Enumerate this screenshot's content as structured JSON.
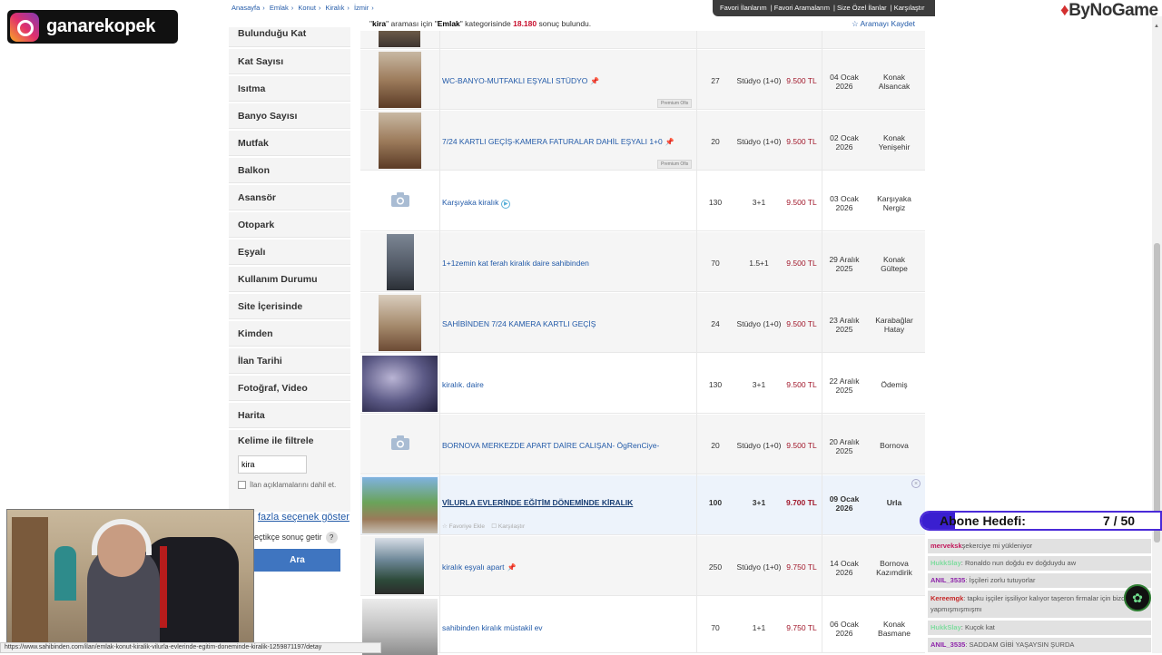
{
  "breadcrumb": [
    "Anasayfa",
    "Emlak",
    "Konut",
    "Kiralık",
    "İzmir"
  ],
  "topnav": [
    "Favori İlanlarım",
    "Favori Aramalarım",
    "Size Özel İlanlar",
    "Karşılaştır"
  ],
  "result_info": {
    "query": "kira",
    "pre": "\"",
    "mid": "\" araması için \"",
    "category": "Emlak",
    "mid2": "\" kategorisinde",
    "count": "18.180",
    "post": "sonuç bulundu."
  },
  "save_search": "☆ Aramayı Kaydet",
  "filters": [
    "Bulunduğu Kat",
    "Kat Sayısı",
    "Isıtma",
    "Banyo Sayısı",
    "Mutfak",
    "Balkon",
    "Asansör",
    "Otopark",
    "Eşyalı",
    "Kullanım Durumu",
    "Site İçerisinde",
    "Kimden",
    "İlan Tarihi",
    "Fotoğraf, Video",
    "Harita"
  ],
  "keyword_filter": {
    "title": "Kelime ile filtrele",
    "value": "kira",
    "checkbox_label": "İlan açıklamalarını dahil et."
  },
  "more_options": "fazla seçenek göster",
  "load_option": "eçtikçe sonuç getir",
  "load_q": "?",
  "search_button": "Ara",
  "listings": [
    {
      "title": "WC-BANYO-MUTFAKLI EŞYALI STÜDYO",
      "pin": "📌",
      "premium": "Premium Ofis",
      "m2": "27",
      "rooms": "Stüdyo (1+0)",
      "price": "9.500 TL",
      "date1": "04 Ocak",
      "date2": "2026",
      "loc1": "Konak",
      "loc2": "Alsancak"
    },
    {
      "title": "7/24 KARTLI GEÇİŞ-KAMERA FATURALAR DAHİL EŞYALI 1+0",
      "pin": "📌",
      "premium": "Premium Ofis",
      "m2": "20",
      "rooms": "Stüdyo (1+0)",
      "price": "9.500 TL",
      "date1": "02 Ocak",
      "date2": "2026",
      "loc1": "Konak",
      "loc2": "Yenişehir"
    },
    {
      "title": "Karşıyaka kiralık",
      "video": "▶",
      "m2": "130",
      "rooms": "3+1",
      "price": "9.500 TL",
      "date1": "03 Ocak",
      "date2": "2026",
      "loc1": "Karşıyaka",
      "loc2": "Nergiz"
    },
    {
      "title": "1+1zemin kat ferah kiralık daire sahibinden",
      "m2": "70",
      "rooms": "1.5+1",
      "price": "9.500 TL",
      "date1": "29 Aralık",
      "date2": "2025",
      "loc1": "Konak",
      "loc2": "Gültepe"
    },
    {
      "title": "SAHİBİNDEN 7/24 KAMERA KARTLI GEÇİŞ",
      "m2": "24",
      "rooms": "Stüdyo (1+0)",
      "price": "9.500 TL",
      "date1": "23 Aralık",
      "date2": "2025",
      "loc1": "Karabağlar",
      "loc2": "Hatay"
    },
    {
      "title": "kiralık. daire",
      "m2": "130",
      "rooms": "3+1",
      "price": "9.500 TL",
      "date1": "22 Aralık",
      "date2": "2025",
      "loc1": "Ödemiş",
      "loc2": ""
    },
    {
      "title": "BORNOVA MERKEZDE APART DAİRE CALIŞAN- ÖgRenCiye-",
      "m2": "20",
      "rooms": "Stüdyo (1+0)",
      "price": "9.500 TL",
      "date1": "20 Aralık",
      "date2": "2025",
      "loc1": "Bornova",
      "loc2": ""
    },
    {
      "title": "VİLURLA EVLERİNDE EĞİTİM DÖNEMİNDE KİRALIK",
      "fav": "☆ Favoriye Ekle",
      "compare": "Karşılaştır",
      "m2": "100",
      "rooms": "3+1",
      "price": "9.700 TL",
      "date1": "09 Ocak",
      "date2": "2026",
      "loc1": "Urla",
      "loc2": ""
    },
    {
      "title": "kiralık eşyalı apart",
      "pin": "📌",
      "m2": "250",
      "rooms": "Stüdyo (1+0)",
      "price": "9.750 TL",
      "date1": "14 Ocak",
      "date2": "2026",
      "loc1": "Bornova",
      "loc2": "Kazımdirik"
    },
    {
      "title": "sahibinden kiralık müstakil ev",
      "m2": "70",
      "rooms": "1+1",
      "price": "9.750 TL",
      "date1": "06 Ocak",
      "date2": "2026",
      "loc1": "Konak",
      "loc2": "Basmane"
    }
  ],
  "overlay": {
    "channel_name": "ganarekopek",
    "brand": "ByNoGame",
    "sub_goal_label": "Abone Hedefi:",
    "sub_goal_count": "7 / 50",
    "sub_goal_progress": 0.14
  },
  "chat": [
    {
      "user": "merveksk",
      "msg": "şekerciye mi yükleniyor",
      "color": "#c2185b"
    },
    {
      "user": "HukkSlay",
      "msg": ": Ronaldo nun doğdu ev doğduydu aw",
      "color": "#7fdc9f"
    },
    {
      "user": "ANIL_3535",
      "msg": ": İşçileri zorlu tutuyorlar",
      "color": "#8e24aa"
    },
    {
      "user": "Kereemgk",
      "msg": ": tapku işçiler işsiliyor kalıyor taşeron firmalar için bizde yapmışmışmışmı",
      "color": "#c62828"
    },
    {
      "user": "HukkSlay",
      "msg": ": Kuçok kat",
      "color": "#7fdc9f"
    },
    {
      "user": "ANIL_3535",
      "msg": ": SADDAM GİBİ YAŞAYSIN ŞURDA",
      "color": "#8e24aa"
    }
  ],
  "status_url": "https://www.sahibinden.com/ilan/emlak-konut-kiralik-vilurla-evlerinde-egitim-doneminde-kiralik-1259871197/detay"
}
